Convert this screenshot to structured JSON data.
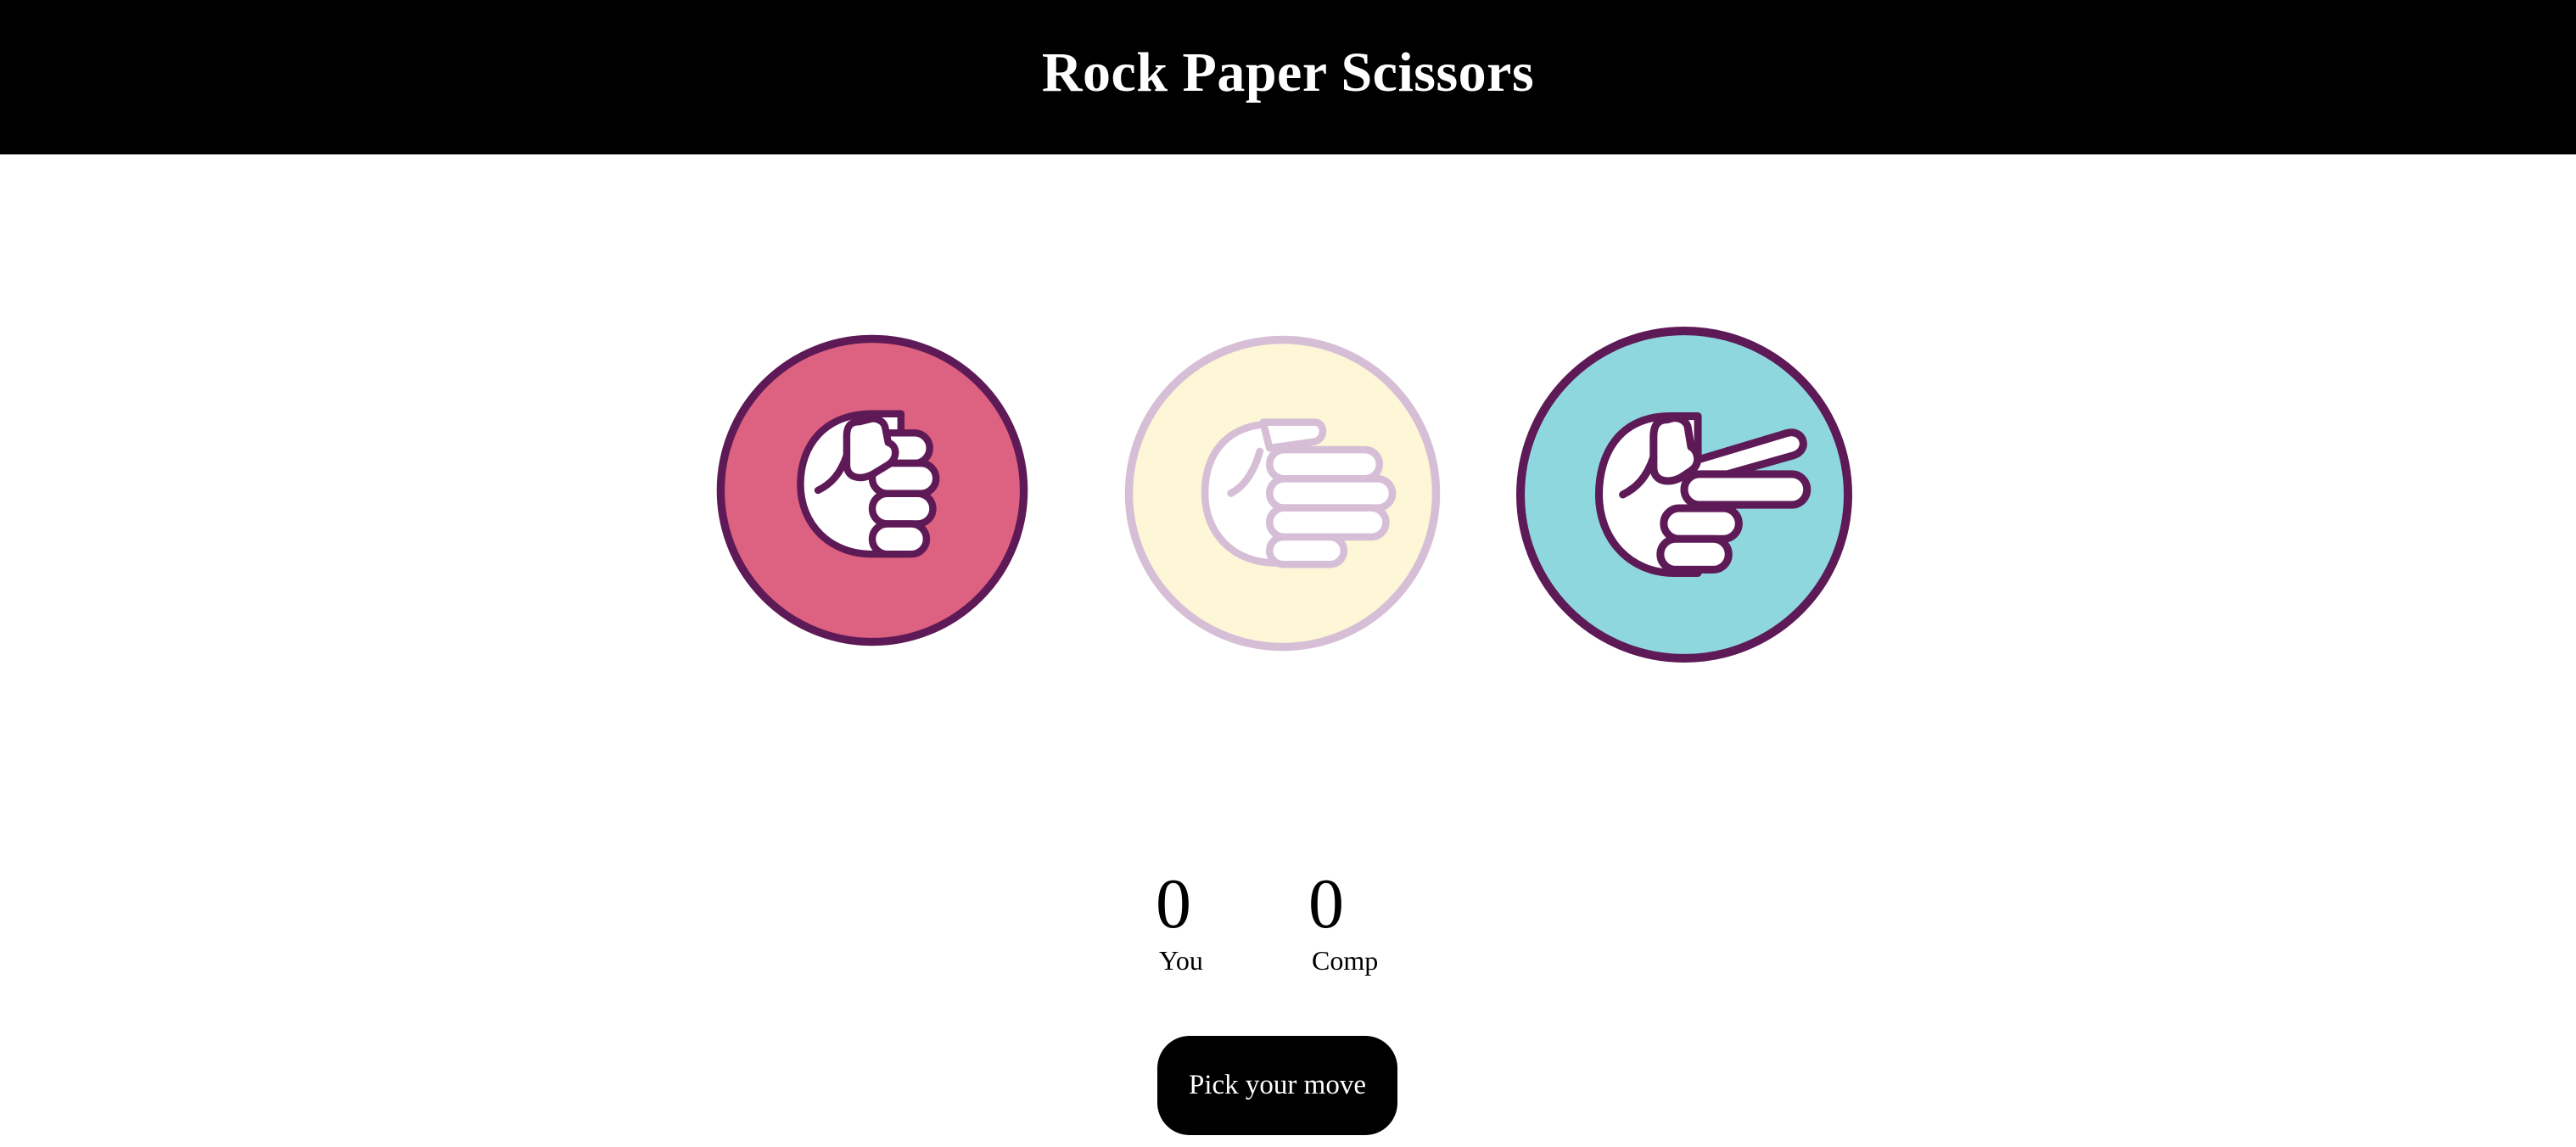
{
  "header": {
    "title": "Rock Paper Scissors"
  },
  "choices": [
    {
      "id": "rock",
      "icon": "rock-fist-icon",
      "fill": "#dd6180",
      "stroke": "#5e1a57",
      "state": "active"
    },
    {
      "id": "paper",
      "icon": "paper-hand-icon",
      "fill": "#fdf7d8",
      "stroke": "#d6bfd6",
      "state": "dimmed"
    },
    {
      "id": "scissors",
      "icon": "scissors-hand-icon",
      "fill": "#8fd7de",
      "stroke": "#5e1a57",
      "state": "active"
    }
  ],
  "scoreboard": {
    "you": {
      "value": "0",
      "label": "You"
    },
    "comp": {
      "value": "0",
      "label": "Comp"
    }
  },
  "action": {
    "label": "Pick your move"
  },
  "colors": {
    "header_bg": "#000000",
    "header_text": "#ffffff",
    "button_bg": "#000000",
    "button_text": "#ffffff",
    "outline": "#5e1a57",
    "hand_fill": "#ffffff"
  }
}
